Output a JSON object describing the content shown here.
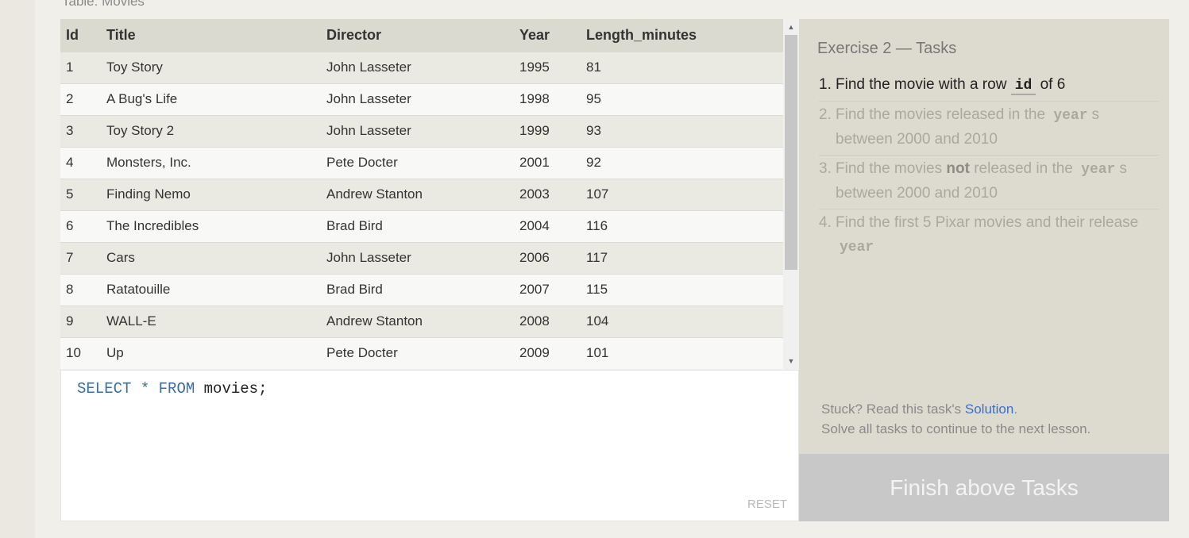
{
  "table": {
    "caption": "Table: Movies",
    "columns": [
      "Id",
      "Title",
      "Director",
      "Year",
      "Length_minutes"
    ],
    "rows": [
      [
        "1",
        "Toy Story",
        "John Lasseter",
        "1995",
        "81"
      ],
      [
        "2",
        "A Bug's Life",
        "John Lasseter",
        "1998",
        "95"
      ],
      [
        "3",
        "Toy Story 2",
        "John Lasseter",
        "1999",
        "93"
      ],
      [
        "4",
        "Monsters, Inc.",
        "Pete Docter",
        "2001",
        "92"
      ],
      [
        "5",
        "Finding Nemo",
        "Andrew Stanton",
        "2003",
        "107"
      ],
      [
        "6",
        "The Incredibles",
        "Brad Bird",
        "2004",
        "116"
      ],
      [
        "7",
        "Cars",
        "John Lasseter",
        "2006",
        "117"
      ],
      [
        "8",
        "Ratatouille",
        "Brad Bird",
        "2007",
        "115"
      ],
      [
        "9",
        "WALL-E",
        "Andrew Stanton",
        "2008",
        "104"
      ],
      [
        "10",
        "Up",
        "Pete Docter",
        "2009",
        "101"
      ]
    ]
  },
  "editor": {
    "kw_select": "SELECT",
    "star": "*",
    "kw_from": "FROM",
    "table_name": "movies;",
    "reset_label": "RESET"
  },
  "tasks": {
    "title": "Exercise 2 — Tasks",
    "items": [
      {
        "num": "1.",
        "pre": "Find the movie with a row ",
        "code": "id",
        "post": " of 6"
      },
      {
        "num": "2.",
        "pre": "Find the movies released in the ",
        "code": "year",
        "post": "s between 2000 and 2010"
      },
      {
        "num": "3.",
        "pre": "Find the movies ",
        "bold": "not",
        "mid": " released in the ",
        "code": "year",
        "post": "s between 2000 and 2010"
      },
      {
        "num": "4.",
        "pre": "Find the first 5 Pixar movies and their release ",
        "code": "year"
      }
    ],
    "hint_prefix": "Stuck? Read this task's ",
    "hint_link": "Solution",
    "hint_suffix": ".",
    "hint_line2": "Solve all tasks to continue to the next lesson."
  },
  "finish_button": "Finish above Tasks",
  "scrollbar": {
    "up_icon": "triangle-up",
    "down_icon": "triangle-down"
  },
  "colors": {
    "link": "#3b70c9",
    "keyword": "#3a6ea5",
    "finish_bg": "#c8c8c8"
  }
}
